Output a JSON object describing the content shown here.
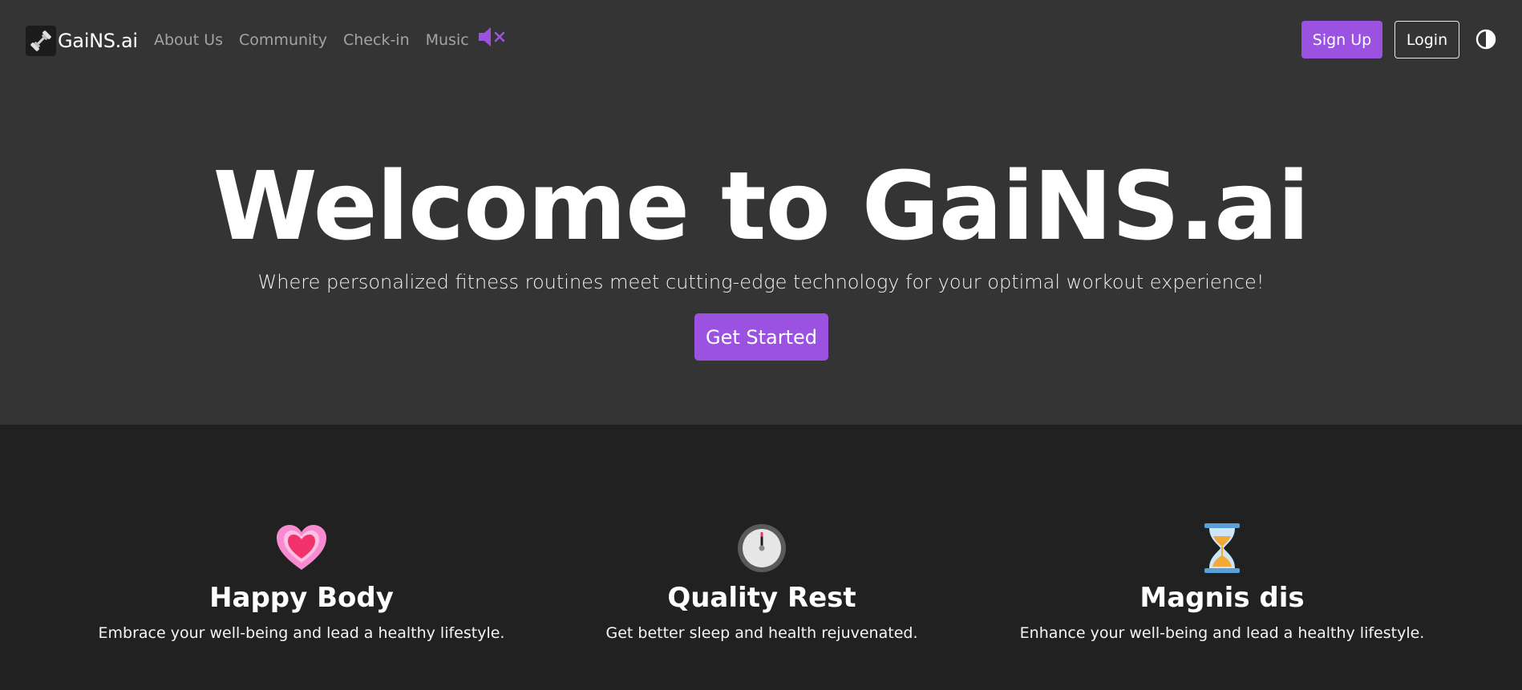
{
  "navbar": {
    "brand": "GaiNS.ai",
    "brand_icon": "dumbbell-icon",
    "links": [
      "About Us",
      "Community",
      "Check-in",
      "Music"
    ],
    "music_icon": "speaker-muted-icon",
    "signup_label": "Sign Up",
    "login_label": "Login",
    "theme_icon": "contrast-icon"
  },
  "hero": {
    "title": "Welcome to GaiNS.ai",
    "subtitle": "Where personalized fitness routines meet cutting-edge technology for your optimal workout experience!",
    "cta_label": "Get Started"
  },
  "features": [
    {
      "icon": "heart-icon",
      "title": "Happy Body",
      "text": "Embrace your well-being and lead a healthy lifestyle."
    },
    {
      "icon": "stopwatch-icon",
      "title": "Quality Rest",
      "text": "Get better sleep and health rejuvenated."
    },
    {
      "icon": "hourglass-icon",
      "title": "Magnis dis",
      "text": "Enhance your well-being and lead a healthy lifestyle."
    }
  ],
  "colors": {
    "accent": "#9b52e0",
    "header_bg": "#343434",
    "body_bg": "#212121"
  }
}
